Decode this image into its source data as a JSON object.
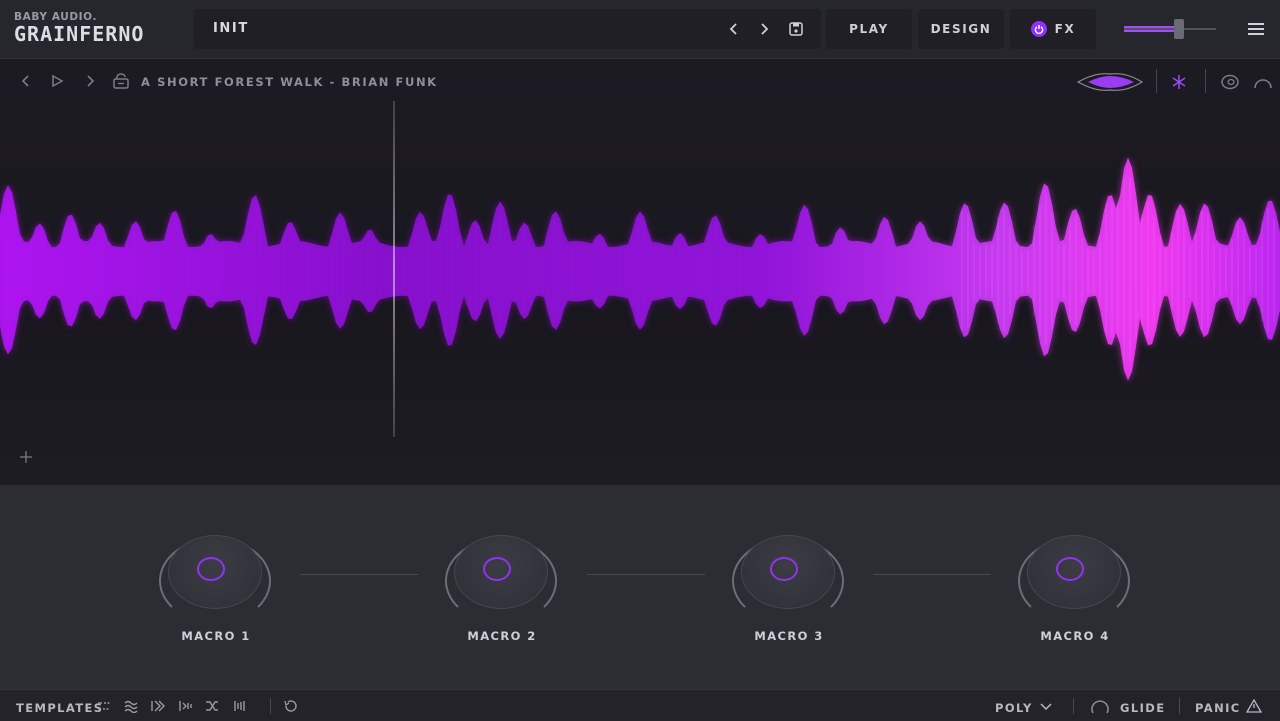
{
  "brand": {
    "vendor": "BABY AUDIO.",
    "product": "GRAINFERNO"
  },
  "preset": {
    "name": "INIT"
  },
  "tabs": [
    {
      "label": "PLAY"
    },
    {
      "label": "DESIGN"
    },
    {
      "label": "FX"
    }
  ],
  "output_level": 0.6,
  "sample": {
    "title": "A SHORT FOREST WALK - BRIAN FUNK"
  },
  "macros": [
    {
      "label": "MACRO 1"
    },
    {
      "label": "MACRO 2"
    },
    {
      "label": "MACRO 3"
    },
    {
      "label": "MACRO 4"
    }
  ],
  "footer": {
    "templates": "TEMPLATES",
    "voice_mode": "POLY",
    "glide": "GLIDE",
    "panic": "PANIC"
  },
  "colors": {
    "accent": "#9130ff",
    "waveform": "#b020ff",
    "background": "#1b1a20",
    "panel": "#2c2c33"
  },
  "icons": {
    "preset_prev": "chevron-left-icon",
    "preset_next": "chevron-right-icon",
    "save": "save-icon",
    "fx_power": "power-icon",
    "menu": "hamburger-menu-icon",
    "sample_prev": "chevron-left-icon",
    "sample_play": "play-icon",
    "sample_next": "chevron-right-icon",
    "sample_lock": "lock-icon",
    "view_mode": "waveform-view-icon",
    "freeze": "snowflake-icon",
    "record": "record-icon",
    "loop": "loop-icon",
    "add_region": "plus-icon",
    "undo": "undo-icon"
  }
}
